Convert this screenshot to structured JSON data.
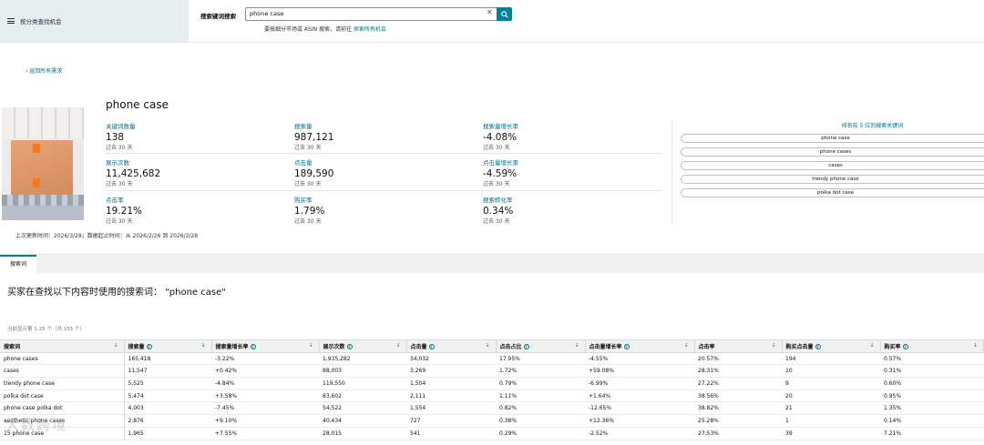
{
  "nav": {
    "menu_label": "按分类查找机会"
  },
  "search": {
    "label": "搜索键词搜索",
    "value": "phone case",
    "hint": "要按细分市场或 ASIN 搜索，请前往",
    "hint_link": "探索所有机会"
  },
  "back_link": "‹ 返回所有需求",
  "keyword_title": "phone case",
  "metrics": [
    {
      "label": "关键词数量",
      "value": "138",
      "sub": ""
    },
    {
      "label": "搜索量",
      "value": "987,121",
      "sub": "过去 30 天"
    },
    {
      "label": "搜索量增长率",
      "value": "-4.08%",
      "sub": "过去 30 天"
    },
    {
      "label": "展示次数",
      "value": "11,425,682",
      "sub": "过去 30 天"
    },
    {
      "label": "点击量",
      "value": "189,590",
      "sub": "过去 30 天"
    },
    {
      "label": "点击量增长率",
      "value": "-4.59%",
      "sub": "过去 30 天"
    },
    {
      "label": "点击率",
      "value": "19.21%",
      "sub": "过去 30 天"
    },
    {
      "label": "购买率",
      "value": "1.79%",
      "sub": "过去 30 天"
    },
    {
      "label": "搜索转化率",
      "value": "0.34%",
      "sub": "过去 30 天"
    }
  ],
  "metric_first_sub": "过去 30 天",
  "top5": {
    "title": "排名前 5 位的搜索关键词",
    "items": [
      "phone case",
      "phone cases",
      "cases",
      "trendy phone case",
      "polka dot case"
    ]
  },
  "updated": "上次更新时间：2026/3/28；数据起止时间：从 2026/2/26 到 2026/3/28",
  "tabs": [
    "搜索词"
  ],
  "headline": "买家在查找以下内容时使用的搜索词：  \"phone case\"",
  "showing": "当前显示第 1-25 个（共 155 个）",
  "table": {
    "headers": [
      "搜索词",
      "搜索量",
      "搜索量增长率",
      "展示次数",
      "点击量",
      "点击占比",
      "点击量增长率",
      "点击率",
      "购买点击量",
      "购买率"
    ],
    "rows": [
      [
        "phone cases",
        "165,418",
        "-3.22%",
        "1,935,282",
        "34,032",
        "17.95%",
        "-4.55%",
        "20.57%",
        "194",
        "0.57%"
      ],
      [
        "cases",
        "11,547",
        "+0.42%",
        "88,003",
        "3,269",
        "1.72%",
        "+59.08%",
        "28.31%",
        "10",
        "0.31%"
      ],
      [
        "trendy phone case",
        "5,525",
        "-4.84%",
        "119,550",
        "1,504",
        "0.79%",
        "-6.99%",
        "27.22%",
        "9",
        "0.60%"
      ],
      [
        "polka dot case",
        "5,474",
        "+3.58%",
        "83,602",
        "2,111",
        "1.11%",
        "+1.64%",
        "38.56%",
        "20",
        "0.95%"
      ],
      [
        "phone case polka dot",
        "4,003",
        "-7.45%",
        "54,522",
        "1,554",
        "0.82%",
        "-12.65%",
        "38.82%",
        "21",
        "1.35%"
      ],
      [
        "aesthetic phone cases",
        "2,876",
        "+9.10%",
        "40,434",
        "727",
        "0.38%",
        "+12.36%",
        "25.28%",
        "1",
        "0.14%"
      ],
      [
        "15 phone case",
        "1,965",
        "+7.55%",
        "28,015",
        "541",
        "0.29%",
        "-2.52%",
        "27.53%",
        "39",
        "7.21%"
      ]
    ]
  },
  "watermark": "大数跨境"
}
